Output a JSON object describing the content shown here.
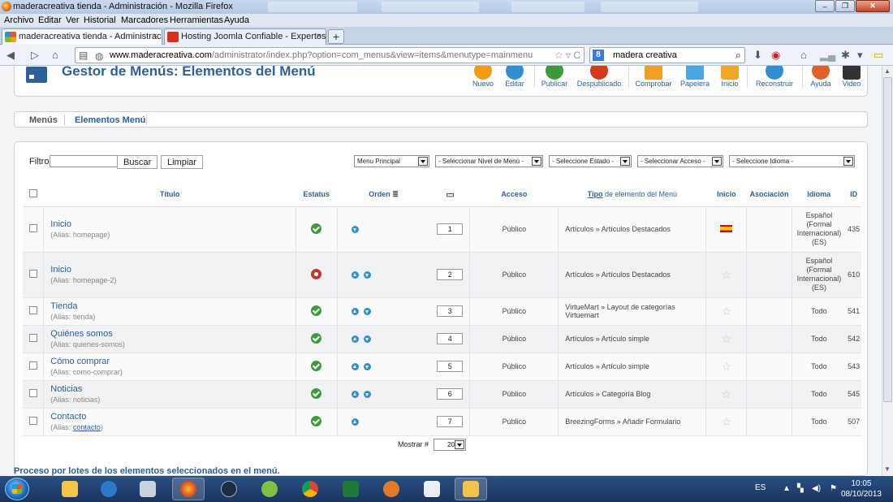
{
  "window": {
    "title": "maderacreativa tienda - Administración - Mozilla Firefox"
  },
  "menu": [
    "Archivo",
    "Editar",
    "Ver",
    "Historial",
    "Marcadores",
    "Herramientas",
    "Ayuda"
  ],
  "tabs": [
    {
      "label": "maderacreativa tienda - Administraci...",
      "close": "×"
    },
    {
      "label": "Hosting Joomla Confiable - Expertos ...",
      "close": "×"
    }
  ],
  "newtab": "+",
  "address": {
    "host": "www.maderacreativa.com",
    "path": "/administrator/index.php?option=com_menus&view=items&menutype=mainmenu"
  },
  "search": {
    "engine": "8",
    "value": "madera creativa"
  },
  "page": {
    "title": "Gestor de Menús: Elementos del Menú",
    "toolbar": [
      {
        "label": "Nuevo",
        "color": "#f39c12"
      },
      {
        "label": "Editar",
        "color": "#2f8fd1"
      },
      {
        "label": "Publicar",
        "color": "#3d9a3a"
      },
      {
        "label": "Despublicado",
        "color": "#d23a1a"
      },
      {
        "label": "Comprobar",
        "color": "#f0a020"
      },
      {
        "label": "Papelera",
        "color": "#4aa6e0"
      },
      {
        "label": "Inicio",
        "color": "#f2a51f"
      },
      {
        "label": "Reconstruir",
        "color": "#2f8fd1"
      },
      {
        "label": "Ayuda",
        "color": "#e0602a"
      },
      {
        "label": "Video",
        "color": "#333333"
      }
    ],
    "subnav": [
      "Menús",
      "Elementos Menú"
    ],
    "filter": {
      "label": "Filtro:",
      "value": "",
      "search_btn": "Buscar",
      "clear_btn": "Limpiar"
    },
    "selects": [
      "Menu Principal",
      "- Seleccionar Nivel de Menú -",
      "- Seleccione Estado -",
      "- Seleccionar Acceso -",
      "- Seleccione Idioma -"
    ],
    "columns": {
      "titulo": "Título",
      "estatus": "Estatus",
      "orden": "Orden",
      "acceso": "Acceso",
      "tipo_link": "Tipo",
      "tipo_rest": " de elemento del Menú",
      "inicio": "Inicio",
      "asociacion": "Asociación",
      "idioma": "Idioma",
      "id": "ID"
    },
    "rows": [
      {
        "title": "Inicio",
        "alias_label": "(Alias:",
        "alias": "homepage",
        "alias_close": ")",
        "status": "published",
        "up": false,
        "down": true,
        "order": "1",
        "access": "Público",
        "type": "Artículos » Artículos Destacados",
        "home": "flag",
        "idioma": [
          "Español",
          "(Formal",
          "Internacional)",
          "(ES)"
        ],
        "id": "435"
      },
      {
        "title": "Inicio",
        "alias_label": "(Alias:",
        "alias": "homepage-2",
        "alias_close": ")",
        "status": "unpublished",
        "up": true,
        "down": true,
        "order": "2",
        "access": "Público",
        "type": "Artículos » Artículos Destacados",
        "home": "star",
        "idioma": [
          "Español",
          "(Formal",
          "Internacional)",
          "(ES)"
        ],
        "id": "610"
      },
      {
        "title": "Tienda",
        "alias_label": "(Alias:",
        "alias": "tienda",
        "alias_close": ")",
        "status": "published",
        "up": true,
        "down": true,
        "order": "3",
        "access": "Público",
        "type": "VirtueMart » Layout de categorías Virtuemart",
        "home": "star",
        "idioma": [
          "Todo"
        ],
        "id": "541"
      },
      {
        "title": "Quiénes somos",
        "alias_label": "(Alias:",
        "alias": "quienes-somos",
        "alias_close": ")",
        "status": "published",
        "up": true,
        "down": true,
        "order": "4",
        "access": "Público",
        "type": "Artículos » Artículo simple",
        "home": "star",
        "idioma": [
          "Todo"
        ],
        "id": "542"
      },
      {
        "title": "Cómo comprar",
        "alias_label": "(Alias:",
        "alias": "como-comprar",
        "alias_close": ")",
        "status": "published",
        "up": true,
        "down": true,
        "order": "5",
        "access": "Público",
        "type": "Artículos » Artículo simple",
        "home": "star",
        "idioma": [
          "Todo"
        ],
        "id": "543"
      },
      {
        "title": "Noticias",
        "alias_label": "(Alias:",
        "alias": "noticias",
        "alias_close": ")",
        "status": "published",
        "up": true,
        "down": true,
        "order": "6",
        "access": "Público",
        "type": "Artículos » Categoría Blog",
        "home": "star",
        "idioma": [
          "Todo"
        ],
        "id": "545"
      },
      {
        "title": "Contacto",
        "alias_label": "(Alias:",
        "alias": "contacto",
        "alias_close": ")",
        "status": "published",
        "up": true,
        "down": false,
        "order": "7",
        "access": "Público",
        "type": "BreezingForms » Añadir Formulario",
        "home": "star",
        "idioma": [
          "Todo"
        ],
        "id": "507"
      }
    ],
    "pagination": {
      "label": "Mostrar #",
      "value": "20"
    },
    "batch": "Proceso por lotes de los elementos seleccionados en el menú."
  },
  "taskbar": {
    "lang": "ES",
    "time": "10:05",
    "date": "08/10/2013",
    "apps": [
      "explorer",
      "media",
      "desktop",
      "firefox",
      "hp",
      "movistar",
      "chrome",
      "excel",
      "tool",
      "calendar",
      "paint"
    ]
  }
}
